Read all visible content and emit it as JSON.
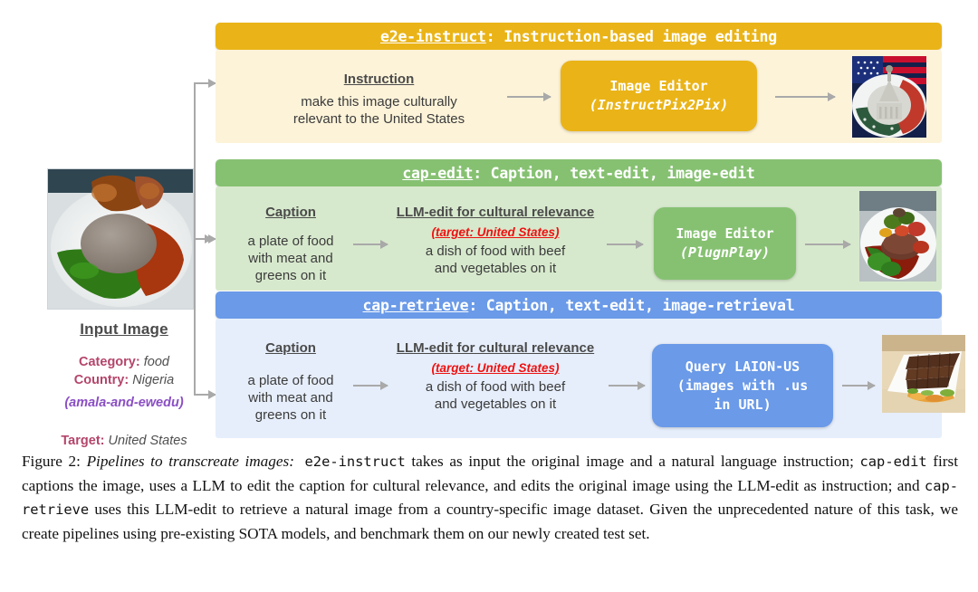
{
  "figure": {
    "input": {
      "title": "Input Image",
      "photo_alt": "amala-and-ewedu-plate-photo",
      "category_key": "Category",
      "category_value": "food",
      "country_key": "Country",
      "country_value": "Nigeria",
      "dish": "(amala-and-ewedu)",
      "target_key": "Target",
      "target_value": "United States"
    },
    "pipelines": [
      {
        "id": "e2e-instruct",
        "name": "e2e-instruct",
        "bar_rest": ": Instruction-based image editing",
        "color": "#eab418",
        "body_color": "#fdf3d9",
        "left_header": "Instruction",
        "left_text_lines": [
          "make this image culturally",
          "relevant to the United States"
        ],
        "model_title": "Image Editor",
        "model_sub": "(InstructPix2Pix)",
        "output_alt": "us-capitol-flag-plate-image"
      },
      {
        "id": "cap-edit",
        "name": "cap-edit",
        "bar_rest": ": Caption, text-edit, image-edit",
        "color": "#86c172",
        "body_color": "#d7e9cd",
        "caption_header": "Caption",
        "caption_lines": [
          "a plate of food",
          "with meat and",
          "greens on it"
        ],
        "edit_header": "LLM-edit for cultural relevance",
        "edit_target": "(target: United States)",
        "edit_lines": [
          "a dish of food with beef",
          "and vegetables on it"
        ],
        "model_title": "Image Editor",
        "model_sub": "(PlugnPlay)",
        "output_alt": "beef-and-vegetables-plate-image"
      },
      {
        "id": "cap-retrieve",
        "name": "cap-retrieve",
        "bar_rest": ": Caption, text-edit, image-retrieval",
        "color": "#6a9ae8",
        "body_color": "#e6eefb",
        "caption_header": "Caption",
        "caption_lines": [
          "a plate of food",
          "with meat and",
          "greens on it"
        ],
        "edit_header": "LLM-edit for cultural relevance",
        "edit_target": "(target: United States)",
        "edit_lines": [
          "a dish of food with beef",
          "and vegetables on it"
        ],
        "model_title": "Query LAION-US",
        "model_sub_lines": [
          "(images with .us",
          "in URL)"
        ],
        "output_alt": "sliced-steak-with-vegetables-platter-image"
      }
    ]
  },
  "caption": {
    "label": "Figure 2:",
    "title": "Pipelines to transcreate images:",
    "part1": " e2e-instruct",
    "part2": " takes as input the original image and a natural language instruction; ",
    "part3": "cap-edit",
    "part4": " first captions the image, uses a LLM to edit the caption for cultural relevance, and edits the original image using the LLM-edit as instruction; and ",
    "part5": "cap-retrieve",
    "part6": " uses this LLM-edit to retrieve a natural image from a country-specific image dataset. Given the unprecedented nature of this task, we create pipelines using pre-existing SOTA models, and benchmark them on our newly created test set."
  }
}
